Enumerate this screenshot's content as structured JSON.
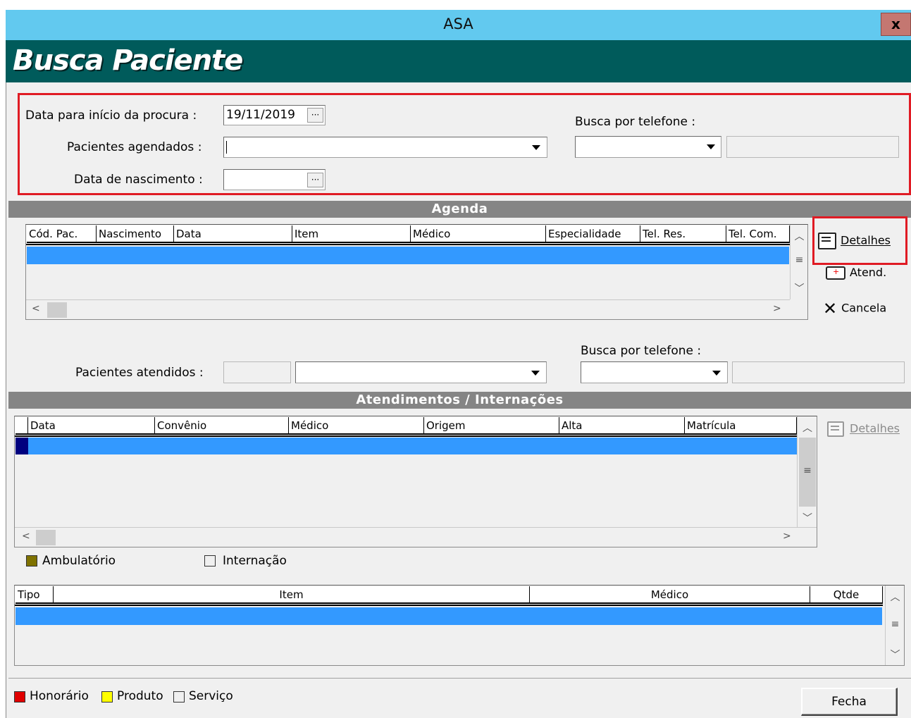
{
  "window": {
    "title": "ASA",
    "close_label": "x",
    "header_title": "Busca Paciente"
  },
  "search": {
    "data_inicio_label": "Data para início da procura :",
    "data_inicio_value": "19/11/2019",
    "ellipsis": "···",
    "agendados_label": "Pacientes agendados :",
    "nascimento_label": "Data de nascimento :",
    "telefone_label": "Busca por telefone :"
  },
  "agenda": {
    "title": "Agenda",
    "columns": [
      "Cód. Pac.",
      "Nascimento",
      "Data",
      "Item",
      "Médico",
      "Especialidade",
      "Tel. Res.",
      "Tel. Com."
    ],
    "buttons": {
      "detalhes": "Detalhes",
      "atend": "Atend.",
      "cancela": "Cancela"
    }
  },
  "atendidos": {
    "telefone_label": "Busca por telefone :",
    "pacientes_label": "Pacientes atendidos :"
  },
  "atendimentos": {
    "title": "Atendimentos / Internações",
    "columns": [
      "Data",
      "Convênio",
      "Médico",
      "Origem",
      "Alta",
      "Matrícula"
    ],
    "detalhes_label": "Detalhes"
  },
  "legend1": {
    "ambulatorio": "Ambulatório",
    "internacao": "Internação"
  },
  "items_grid": {
    "columns": [
      "Tipo",
      "Item",
      "Médico",
      "Qtde"
    ]
  },
  "legend2": {
    "honorario": "Honorário",
    "produto": "Produto",
    "servico": "Serviço"
  },
  "footer": {
    "fecha_label": "Fecha"
  },
  "colors": {
    "header_bg": "#005b5b",
    "titlebar_bg": "#62c9ef",
    "selection": "#3399ff",
    "highlight_border": "#e01b24",
    "honorario": "#e00000",
    "produto": "#ffff00",
    "ambulatorio": "#7f7200"
  }
}
